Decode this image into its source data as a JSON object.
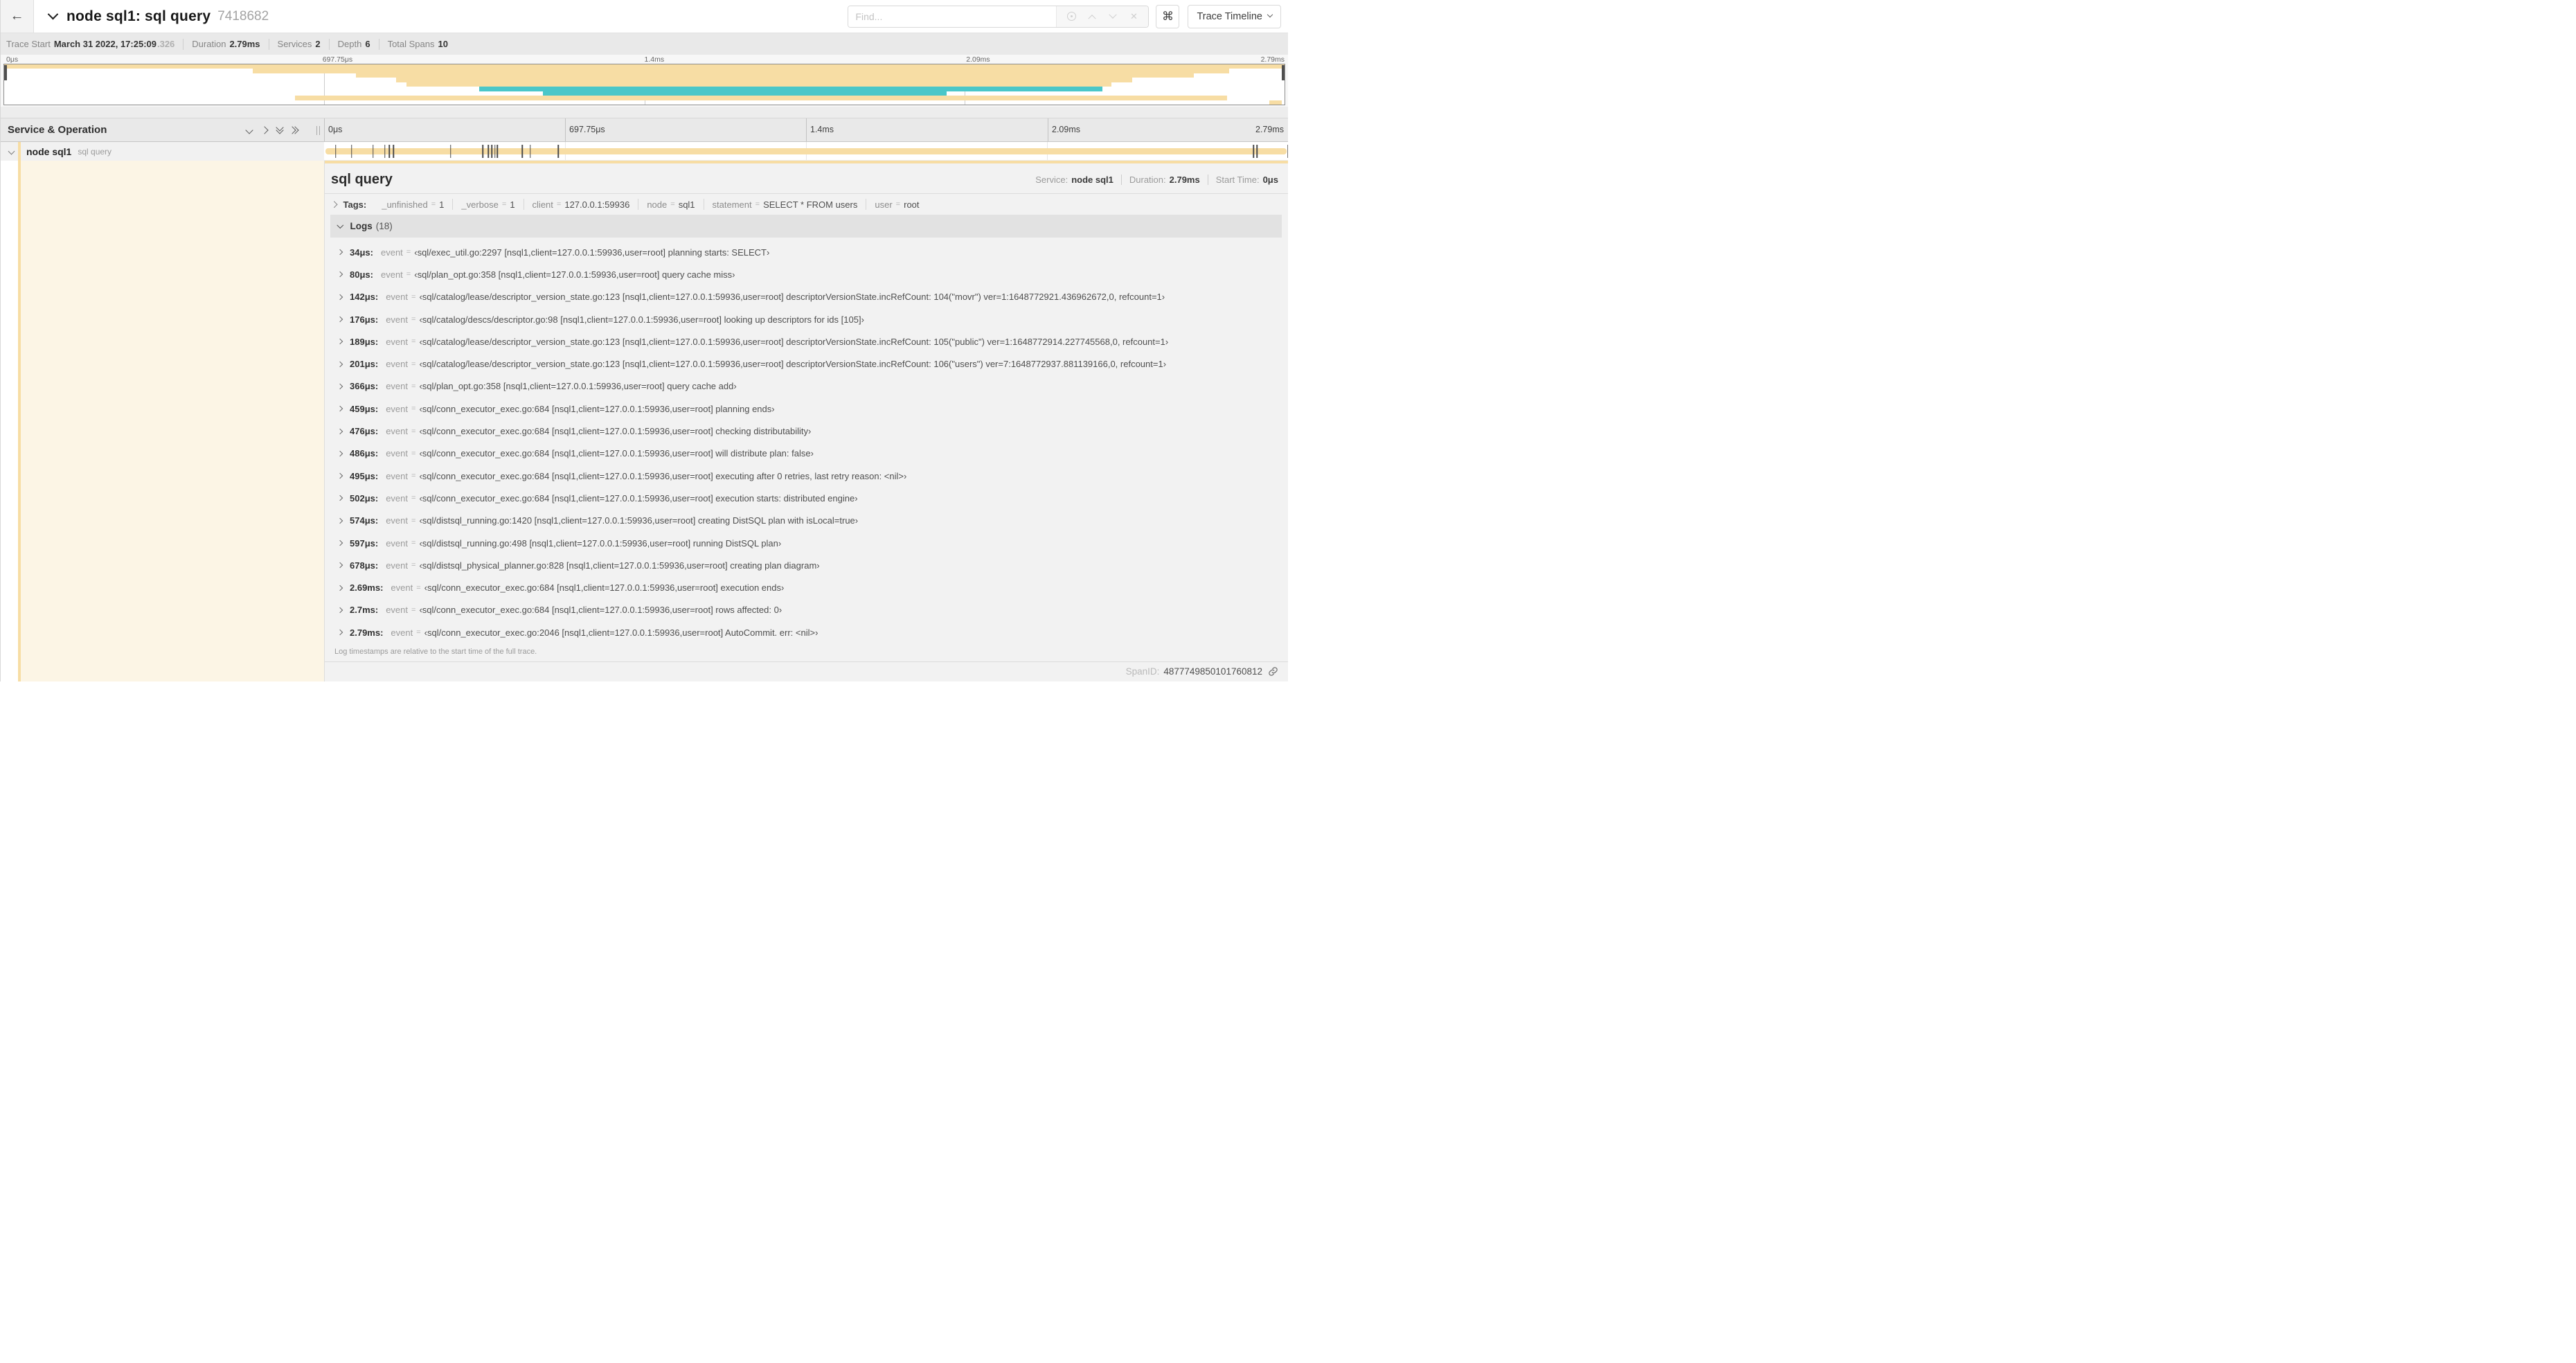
{
  "colors": {
    "tan": "#F7DDA4",
    "teal": "#4AC7C9",
    "cream": "#FCF5E5"
  },
  "header": {
    "title": "node sql1: sql query",
    "trace_id": "7418682",
    "find_placeholder": "Find...",
    "shortcut_symbol": "⌘",
    "view_selector": "Trace Timeline"
  },
  "trace_bar": {
    "items": [
      {
        "label": "Trace Start",
        "value": "March 31 2022, 17:25:09",
        "suffix": ".326"
      },
      {
        "label": "Duration",
        "value": "2.79ms",
        "suffix": ""
      },
      {
        "label": "Services",
        "value": "2",
        "suffix": ""
      },
      {
        "label": "Depth",
        "value": "6",
        "suffix": ""
      },
      {
        "label": "Total Spans",
        "value": "10",
        "suffix": ""
      }
    ]
  },
  "minimap": {
    "ticks": [
      {
        "label": "0μs"
      },
      {
        "label": "697.75μs"
      },
      {
        "label": "1.4ms"
      },
      {
        "label": "2.09ms"
      },
      {
        "label": "2.79ms"
      }
    ],
    "bars": [
      {
        "start": 0.0,
        "end": 1.0,
        "color": "tan"
      },
      {
        "start": 0.194,
        "end": 0.957,
        "color": "tan"
      },
      {
        "start": 0.275,
        "end": 0.929,
        "color": "tan"
      },
      {
        "start": 0.306,
        "end": 0.881,
        "color": "tan"
      },
      {
        "start": 0.314,
        "end": 0.865,
        "color": "tan"
      },
      {
        "start": 0.371,
        "end": 0.858,
        "color": "teal"
      },
      {
        "start": 0.421,
        "end": 0.736,
        "color": "teal"
      },
      {
        "start": 0.227,
        "end": 0.955,
        "color": "tan"
      },
      {
        "start": 0.988,
        "end": 0.998,
        "color": "tan"
      }
    ]
  },
  "timeline": {
    "duration_us": 2790,
    "left_header": "Service & Operation",
    "ticks": [
      {
        "label": "0μs",
        "pos": 0
      },
      {
        "label": "697.75μs",
        "pos": 0.25
      },
      {
        "label": "1.4ms",
        "pos": 0.5
      },
      {
        "label": "2.09ms",
        "pos": 0.75
      },
      {
        "label": "2.79ms",
        "pos": 1
      }
    ],
    "row": {
      "service": "node sql1",
      "operation": "sql query"
    }
  },
  "span_detail": {
    "title": "sql query",
    "meta": [
      {
        "label": "Service:",
        "value": "node sql1"
      },
      {
        "label": "Duration:",
        "value": "2.79ms"
      },
      {
        "label": "Start Time:",
        "value": "0μs"
      }
    ],
    "kv_separator": "=",
    "tags_label": "Tags:",
    "tags": [
      {
        "key": "_unfinished",
        "value": "1"
      },
      {
        "key": "_verbose",
        "value": "1"
      },
      {
        "key": "client",
        "value": "127.0.0.1:59936"
      },
      {
        "key": "node",
        "value": "sql1"
      },
      {
        "key": "statement",
        "value": "SELECT * FROM users"
      },
      {
        "key": "user",
        "value": "root"
      }
    ],
    "logs_label": "Logs",
    "logs_count": "(18)",
    "log_key": "event",
    "logs": [
      {
        "t": "34μs:",
        "us": 34,
        "v": "‹sql/exec_util.go:2297 [nsql1,client=127.0.0.1:59936,user=root] planning starts: SELECT›"
      },
      {
        "t": "80μs:",
        "us": 80,
        "v": "‹sql/plan_opt.go:358 [nsql1,client=127.0.0.1:59936,user=root] query cache miss›"
      },
      {
        "t": "142μs:",
        "us": 142,
        "v": "‹sql/catalog/lease/descriptor_version_state.go:123 [nsql1,client=127.0.0.1:59936,user=root] descriptorVersionState.incRefCount: 104(\"movr\") ver=1:1648772921.436962672,0, refcount=1›"
      },
      {
        "t": "176μs:",
        "us": 176,
        "v": "‹sql/catalog/descs/descriptor.go:98 [nsql1,client=127.0.0.1:59936,user=root] looking up descriptors for ids [105]›"
      },
      {
        "t": "189μs:",
        "us": 189,
        "v": "‹sql/catalog/lease/descriptor_version_state.go:123 [nsql1,client=127.0.0.1:59936,user=root] descriptorVersionState.incRefCount: 105(\"public\") ver=1:1648772914.227745568,0, refcount=1›"
      },
      {
        "t": "201μs:",
        "us": 201,
        "v": "‹sql/catalog/lease/descriptor_version_state.go:123 [nsql1,client=127.0.0.1:59936,user=root] descriptorVersionState.incRefCount: 106(\"users\") ver=7:1648772937.881139166,0, refcount=1›"
      },
      {
        "t": "366μs:",
        "us": 366,
        "v": "‹sql/plan_opt.go:358 [nsql1,client=127.0.0.1:59936,user=root] query cache add›"
      },
      {
        "t": "459μs:",
        "us": 459,
        "v": "‹sql/conn_executor_exec.go:684 [nsql1,client=127.0.0.1:59936,user=root] planning ends›"
      },
      {
        "t": "476μs:",
        "us": 476,
        "v": "‹sql/conn_executor_exec.go:684 [nsql1,client=127.0.0.1:59936,user=root] checking distributability›"
      },
      {
        "t": "486μs:",
        "us": 486,
        "v": "‹sql/conn_executor_exec.go:684 [nsql1,client=127.0.0.1:59936,user=root] will distribute plan: false›"
      },
      {
        "t": "495μs:",
        "us": 495,
        "v": "‹sql/conn_executor_exec.go:684 [nsql1,client=127.0.0.1:59936,user=root] executing after 0 retries, last retry reason: <nil>›"
      },
      {
        "t": "502μs:",
        "us": 502,
        "v": "‹sql/conn_executor_exec.go:684 [nsql1,client=127.0.0.1:59936,user=root] execution starts: distributed engine›"
      },
      {
        "t": "574μs:",
        "us": 574,
        "v": "‹sql/distsql_running.go:1420 [nsql1,client=127.0.0.1:59936,user=root] creating DistSQL plan with isLocal=true›"
      },
      {
        "t": "597μs:",
        "us": 597,
        "v": "‹sql/distsql_running.go:498 [nsql1,client=127.0.0.1:59936,user=root] running DistSQL plan›"
      },
      {
        "t": "678μs:",
        "us": 678,
        "v": "‹sql/distsql_physical_planner.go:828 [nsql1,client=127.0.0.1:59936,user=root] creating plan diagram›"
      },
      {
        "t": "2.69ms:",
        "us": 2690,
        "v": "‹sql/conn_executor_exec.go:684 [nsql1,client=127.0.0.1:59936,user=root] execution ends›"
      },
      {
        "t": "2.7ms:",
        "us": 2700,
        "v": "‹sql/conn_executor_exec.go:684 [nsql1,client=127.0.0.1:59936,user=root] rows affected: 0›"
      },
      {
        "t": "2.79ms:",
        "us": 2790,
        "v": "‹sql/conn_executor_exec.go:2046 [nsql1,client=127.0.0.1:59936,user=root] AutoCommit. err: <nil>›"
      }
    ],
    "footer_note": "Log timestamps are relative to the start time of the full trace.",
    "span_id_label": "SpanID:",
    "span_id": "4877749850101760812"
  }
}
